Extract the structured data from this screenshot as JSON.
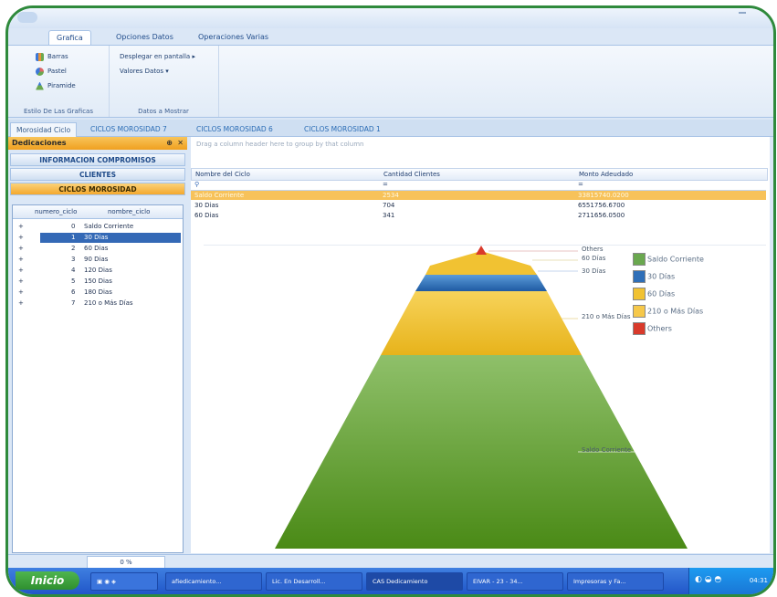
{
  "ribbon_tabs": [
    "Grafica",
    "Opciones Datos",
    "Operaciones Varias"
  ],
  "ribbon": {
    "style_group": {
      "title": "Estilo De Las Graficas",
      "items": [
        {
          "label": "Barras",
          "icon": "bar-chart-icon"
        },
        {
          "label": "Pastel",
          "icon": "pie-chart-icon"
        },
        {
          "label": "Piramide",
          "icon": "pyramid-chart-icon"
        }
      ]
    },
    "data_group": {
      "title": "Datos a Mostrar",
      "items": [
        {
          "label": "Desplegar en pantalla"
        },
        {
          "label": "Valores Datos"
        }
      ]
    }
  },
  "doc_tabs": [
    "Morosidad Ciclo",
    "CICLOS MOROSIDAD 7",
    "CICLOS MOROSIDAD 6",
    "CICLOS MOROSIDAD 1"
  ],
  "left_panel": {
    "title": "Dedicaciones",
    "sections": [
      "INFORMACION COMPROMISOS",
      "CLIENTES",
      "CICLOS MOROSIDAD"
    ],
    "grid": {
      "columns": [
        "numero_ciclo",
        "nombre_ciclo"
      ],
      "rows": [
        {
          "num": "0",
          "name": "Saldo Corriente"
        },
        {
          "num": "1",
          "name": "30 Dias"
        },
        {
          "num": "2",
          "name": "60 Dias"
        },
        {
          "num": "3",
          "name": "90 Dias"
        },
        {
          "num": "4",
          "name": "120 Dias"
        },
        {
          "num": "5",
          "name": "150 Dias"
        },
        {
          "num": "6",
          "name": "180 Dias"
        },
        {
          "num": "7",
          "name": "210 o Más Días"
        }
      ]
    }
  },
  "table": {
    "group_hint": "Drag a column header here to group by that column",
    "columns": [
      "Nombre del Ciclo",
      "Cantidad Clientes",
      "Monto Adeudado"
    ],
    "rows": [
      {
        "c1": "Saldo Corriente",
        "c2": "2534",
        "c3": "33815740.0200"
      },
      {
        "c1": "30 Dias",
        "c2": "704",
        "c3": "6551756.6700"
      },
      {
        "c1": "60 Dias",
        "c2": "341",
        "c3": "2711656.0500"
      }
    ]
  },
  "chart_labels": {
    "others": "Others",
    "d60": "60 Días",
    "d30": "30 Días",
    "d210": "210 o Más Días",
    "saldo": "Saldo Corriente"
  },
  "legend": [
    {
      "label": "Saldo Corriente",
      "color": "#6aa84f"
    },
    {
      "label": "30 Días",
      "color": "#2f6fb8"
    },
    {
      "label": "60 Días",
      "color": "#f1c232"
    },
    {
      "label": "210 o Más Días",
      "color": "#f6c84a"
    },
    {
      "label": "Others",
      "color": "#d93a2b"
    }
  ],
  "status": {
    "percent": "0 %"
  },
  "taskbar": {
    "start": "Inicio",
    "items": [
      "afiedicamiento...",
      "Lic. En Desarroll...",
      "CAS Dedicamiento",
      "EIVAR - 23 - 34...",
      "Impresoras y Fa..."
    ],
    "clock": "04:31"
  },
  "colors": {
    "accent": "#f4a82d",
    "selection": "#3469b6",
    "frame": "#2f8a3c"
  }
}
